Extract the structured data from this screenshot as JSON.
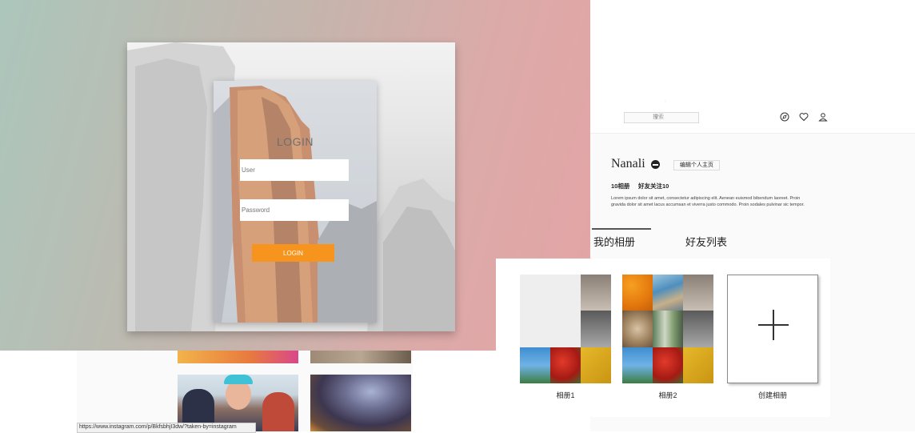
{
  "background_page": {
    "status_url": "https://www.instagram.com/p/BkfsbhjI3dw/?taken-by=instagram"
  },
  "login": {
    "title": "LOGIN",
    "user_placeholder": "User",
    "password_placeholder": "Password",
    "button_label": "LOGIN"
  },
  "profile": {
    "search_placeholder": "搜索",
    "search_icon": "magnifier",
    "username": "Nanali",
    "edit_label": "编辑个人主页",
    "stats": [
      "10相册",
      "好友关注10"
    ],
    "bio": "Lorem ipsum dolor sit amet, consectetur adipiscing elit. Aenean euismod bibendum laoreet. Proin gravida dolor sit amet lacus accumsan et viverra justo commodo. Proin sodales pulvinar sic tempor.",
    "tabs": [
      "我的相册",
      "好友列表"
    ],
    "albums": [
      {
        "label": "相册1"
      },
      {
        "label": "相册2"
      }
    ],
    "create_label": "创建相册",
    "nav_icons": [
      "compass-icon",
      "heart-icon",
      "user-icon"
    ]
  }
}
